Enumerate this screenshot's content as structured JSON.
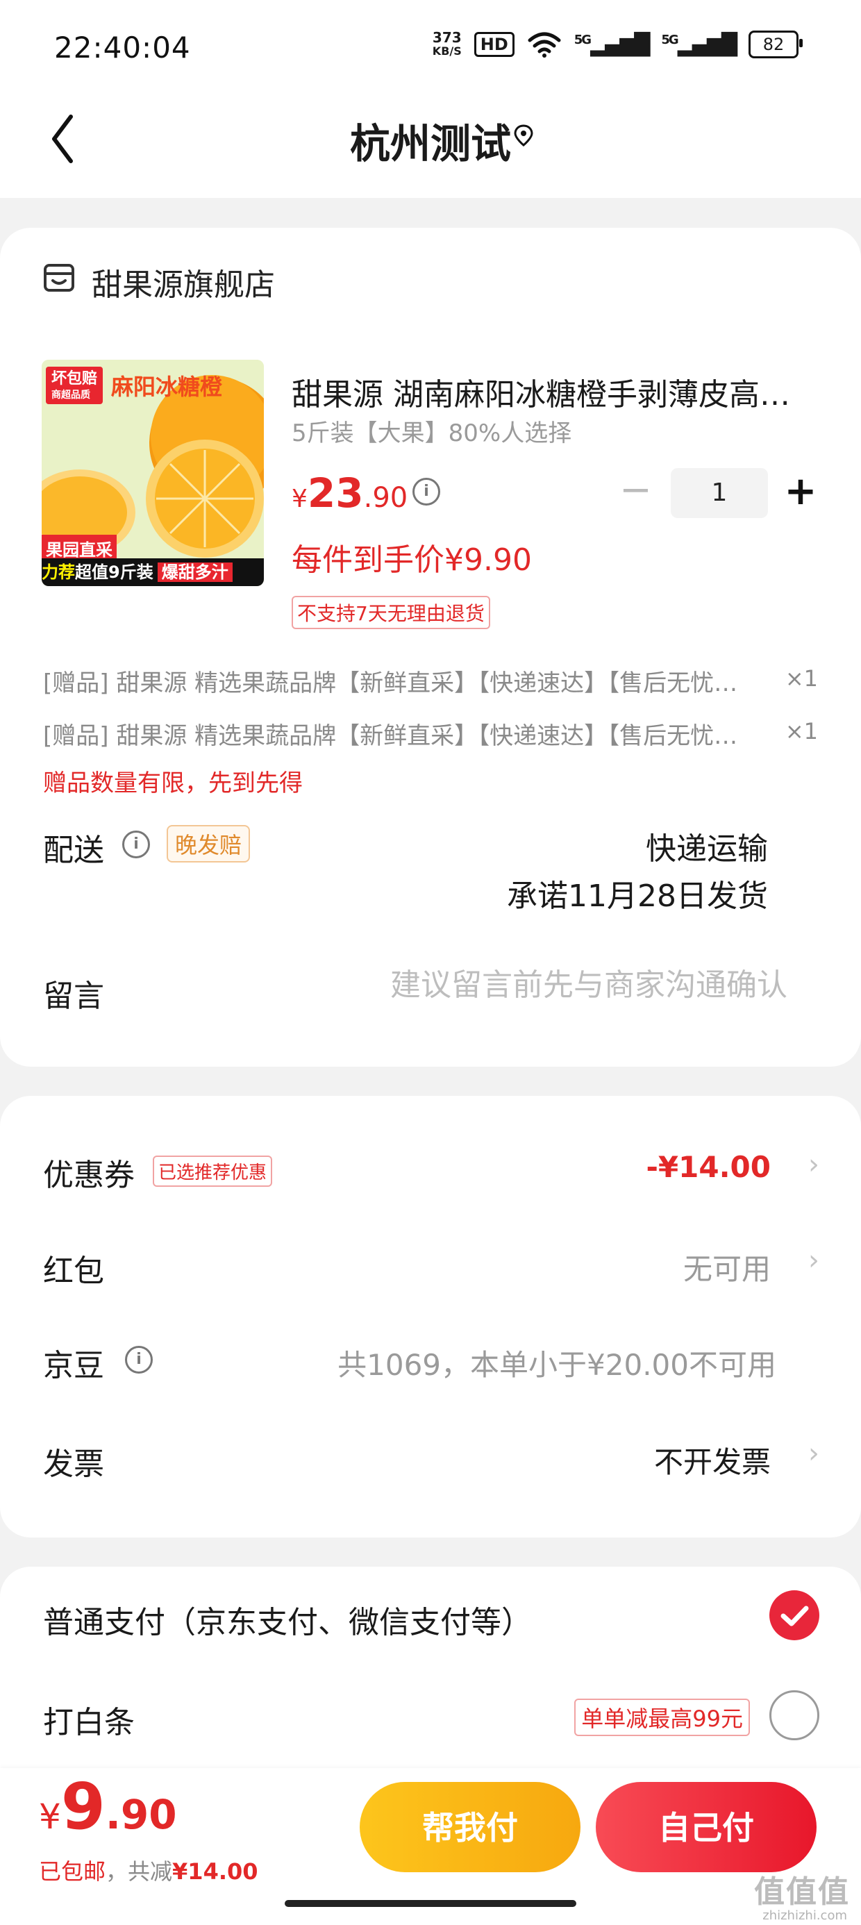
{
  "status_bar": {
    "time": "22:40:04",
    "net_speed_top": "373",
    "net_speed_bottom": "KB/S",
    "hd": "HD",
    "sig1": "5G",
    "sig2": "5G",
    "battery": "82"
  },
  "nav": {
    "title": "杭州测试"
  },
  "store": {
    "name": "甜果源旗舰店"
  },
  "product": {
    "image_texts": {
      "badge_top": "坏包赔",
      "badge_sub": "商超品质",
      "name": "麻阳冰糖橙",
      "tag_left": "果园直采",
      "bottom_left": "力荐",
      "bottom_hl": "超值9斤装",
      "bottom_right": "爆甜多汁"
    },
    "title": "甜果源 湖南麻阳冰糖橙手剥薄皮高…",
    "spec": "5斤装【大果】80%人选择",
    "price_symbol": "¥",
    "price_int": "23",
    "price_dec": ".90",
    "quantity": "1",
    "arrive_price": "每件到手价¥9.90",
    "return_policy": "不支持7天无理由退货"
  },
  "gifts": [
    {
      "text": "[赠品] 甜果源 精选果蔬品牌【新鲜直采】【快递速达】【售后无忧…",
      "qty": "×1"
    },
    {
      "text": "[赠品] 甜果源 精选果蔬品牌【新鲜直采】【快递速达】【售后无忧…",
      "qty": "×1"
    }
  ],
  "gift_note": "赠品数量有限，先到先得",
  "delivery": {
    "label": "配送",
    "late_badge": "晚发赔",
    "method": "快递运输",
    "promise": "承诺11月28日发货"
  },
  "message": {
    "label": "留言",
    "placeholder": "建议留言前先与商家沟通确认"
  },
  "discounts": {
    "coupon": {
      "label": "优惠券",
      "badge": "已选推荐优惠",
      "value": "-¥14.00",
      "color": "#e22828"
    },
    "red_packet": {
      "label": "红包",
      "value": "无可用"
    },
    "jd_beans": {
      "label": "京豆",
      "value": "共1069，本单小于¥20.00不可用"
    },
    "invoice": {
      "label": "发票",
      "value": "不开发票"
    }
  },
  "payment": {
    "normal": {
      "label": "普通支付（京东支付、微信支付等）",
      "selected": true
    },
    "baitiao": {
      "label": "打白条",
      "badge": "单单减最高99元",
      "selected": false
    }
  },
  "bottom": {
    "price_symbol": "¥",
    "total_int": "9",
    "total_dec": ".90",
    "free_shipping": "已包邮",
    "saved_prefix": "，共减",
    "saved_value": "¥14.00",
    "help_pay": "帮我付",
    "self_pay": "自己付"
  },
  "watermark": {
    "text": "值值值",
    "url": "zhizhizhi.com"
  }
}
